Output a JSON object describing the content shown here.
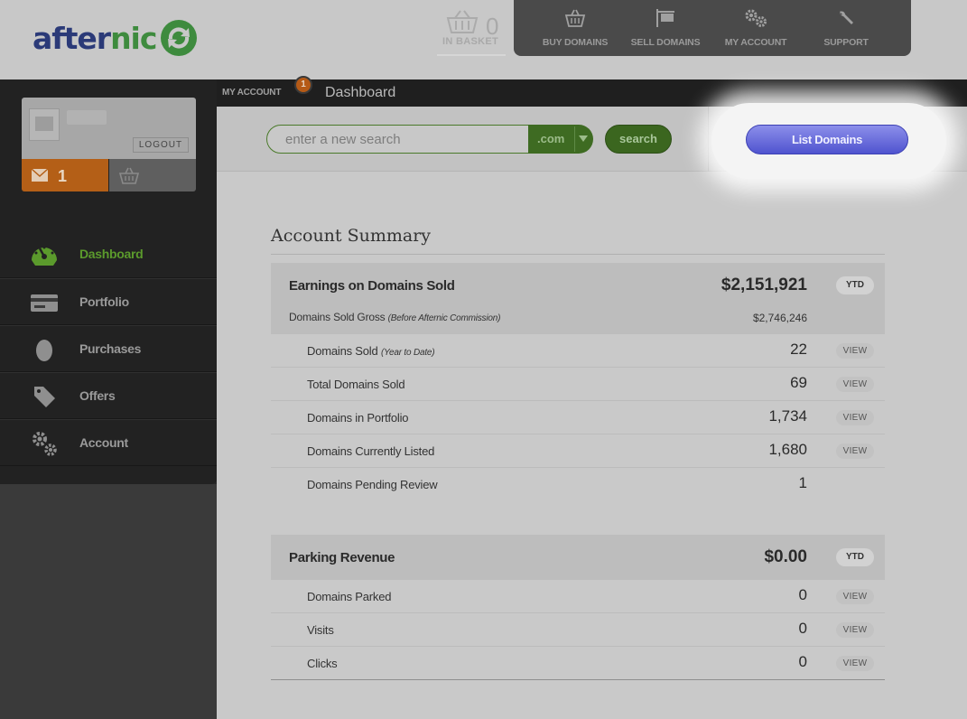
{
  "header": {
    "logo": {
      "part1": "after",
      "part2": "nic"
    },
    "basket": {
      "count": "0",
      "label": "IN BASKET"
    },
    "nav": [
      {
        "label": "BUY DOMAINS",
        "icon": "basket-icon"
      },
      {
        "label": "SELL DOMAINS",
        "icon": "sign-icon"
      },
      {
        "label": "MY ACCOUNT",
        "icon": "gears-icon"
      },
      {
        "label": "SUPPORT",
        "icon": "wrench-icon"
      }
    ]
  },
  "sidebar": {
    "logout_label": "LOGOUT",
    "messages_count": "1",
    "items": [
      {
        "label": "Dashboard",
        "icon": "gauge-icon",
        "active": true
      },
      {
        "label": "Portfolio",
        "icon": "card-icon"
      },
      {
        "label": "Purchases",
        "icon": "egg-icon"
      },
      {
        "label": "Offers",
        "icon": "tag-icon"
      },
      {
        "label": "Account",
        "icon": "gears-icon"
      }
    ]
  },
  "breadcrumb": {
    "parent": "MY ACCOUNT",
    "badge": "1",
    "title": "Dashboard"
  },
  "search": {
    "placeholder": "enter a new search",
    "tld": ".com",
    "button": "search",
    "list_button": "List Domains"
  },
  "summary": {
    "title": "Account Summary",
    "earnings": {
      "title": "Earnings on Domains Sold",
      "amount": "$2,151,921",
      "badge": "YTD",
      "gross_label": "Domains Sold Gross",
      "gross_note": "(Before Afternic Commission)",
      "gross_value": "$2,746,246",
      "rows": [
        {
          "label": "Domains Sold",
          "note": "(Year to Date)",
          "value": "22",
          "view": "VIEW"
        },
        {
          "label": "Total Domains Sold",
          "note": "",
          "value": "69",
          "view": "VIEW"
        },
        {
          "label": "Domains in Portfolio",
          "note": "",
          "value": "1,734",
          "view": "VIEW"
        },
        {
          "label": "Domains Currently Listed",
          "note": "",
          "value": "1,680",
          "view": "VIEW"
        },
        {
          "label": "Domains Pending Review",
          "note": "",
          "value": "1",
          "view": ""
        }
      ]
    },
    "parking": {
      "title": "Parking Revenue",
      "amount": "$0.00",
      "badge": "YTD",
      "rows": [
        {
          "label": "Domains Parked",
          "value": "0",
          "view": "VIEW"
        },
        {
          "label": "Visits",
          "value": "0",
          "view": "VIEW"
        },
        {
          "label": "Clicks",
          "value": "0",
          "view": "VIEW"
        }
      ]
    }
  },
  "colors": {
    "brand_blue": "#2b3a78",
    "brand_green": "#3e8b3e",
    "active_green": "#5b9a2c",
    "list_button": "#6a6de0",
    "message_orange": "#b45f17"
  }
}
